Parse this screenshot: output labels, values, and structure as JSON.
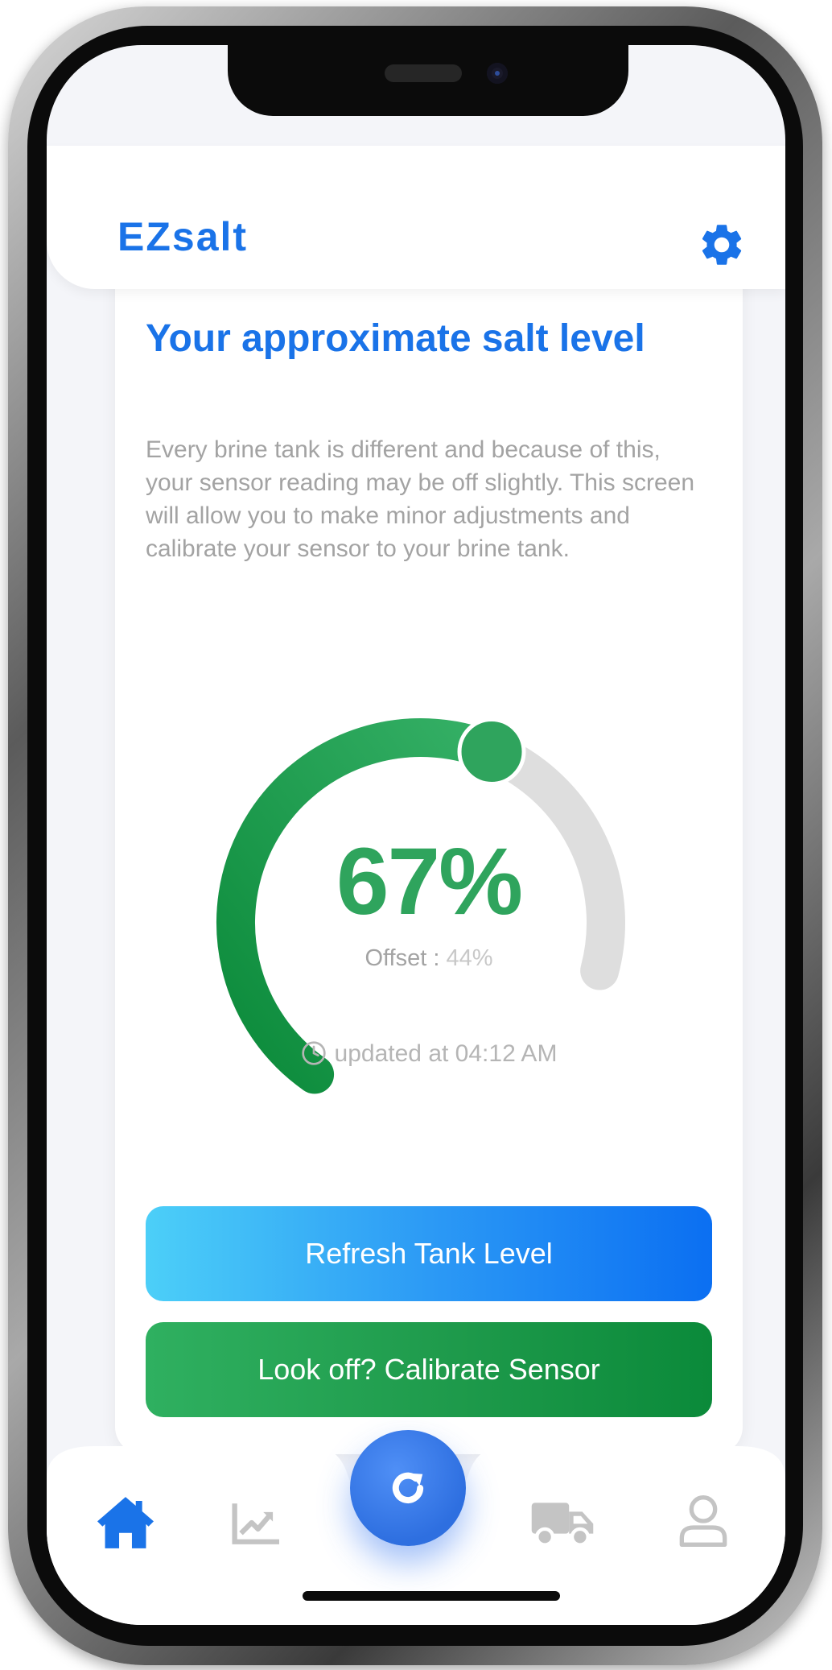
{
  "app": {
    "title": "EZsalt",
    "settings_icon": "gear-icon"
  },
  "card": {
    "title": "Your approximate salt level",
    "description": "Every brine tank is different and because of this, your sensor reading may be off slightly. This screen will allow you to make minor adjustments and calibrate your sensor to your brine tank."
  },
  "gauge": {
    "level_text": "67%",
    "level_fraction": 0.67,
    "offset_label": "Offset : ",
    "offset_value": "44%",
    "updated_label": "updated at  04:12 AM",
    "fill_color": "#2fa45d",
    "track_color": "#dedede"
  },
  "buttons": {
    "refresh_label": "Refresh Tank Level",
    "calibrate_label": "Look off? Calibrate Sensor"
  },
  "nav": {
    "items": [
      {
        "icon": "home-icon",
        "active": true
      },
      {
        "icon": "chart-icon",
        "active": false
      },
      {
        "icon": "refresh-icon",
        "active": false
      },
      {
        "icon": "truck-icon",
        "active": false
      },
      {
        "icon": "user-icon",
        "active": false
      }
    ],
    "active_color": "#1a73e8",
    "inactive_color": "#c4c4c4"
  }
}
